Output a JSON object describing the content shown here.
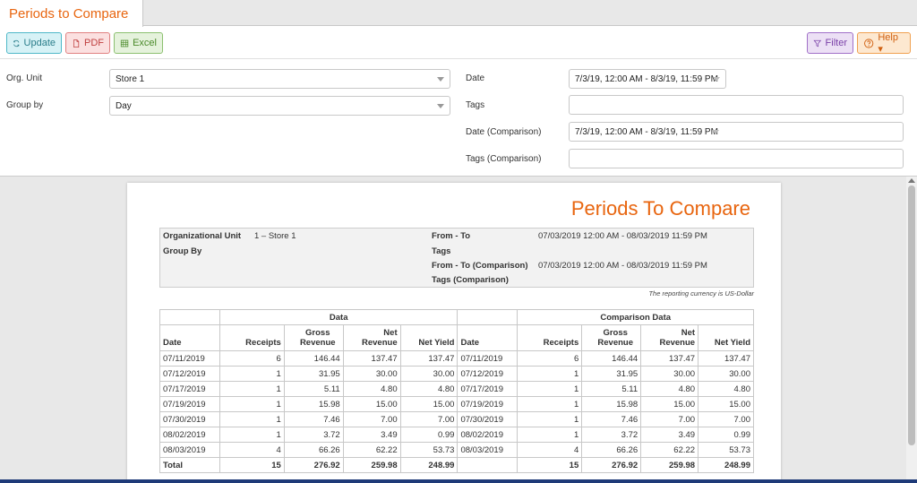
{
  "tab": {
    "title": "Periods to Compare"
  },
  "toolbar": {
    "update": "Update",
    "pdf": "PDF",
    "excel": "Excel",
    "filter": "Filter",
    "help": "Help ▾"
  },
  "form": {
    "org_unit_label": "Org. Unit",
    "org_unit_value": "Store 1",
    "group_by_label": "Group by",
    "group_by_value": "Day",
    "date_label": "Date",
    "date_value": "7/3/19, 12:00 AM - 8/3/19, 11:59 PM",
    "tags_label": "Tags",
    "tags_value": "",
    "date_cmp_label": "Date (Comparison)",
    "date_cmp_value": "7/3/19, 12:00 AM - 8/3/19, 11:59 PM",
    "tags_cmp_label": "Tags (Comparison)",
    "tags_cmp_value": ""
  },
  "report": {
    "title": "Periods To Compare",
    "info": {
      "org_unit_label": "Organizational Unit",
      "org_unit_value": "1 – Store 1",
      "group_by_label": "Group By",
      "from_to_label": "From - To",
      "from_to_value": "07/03/2019 12:00 AM - 08/03/2019 11:59 PM",
      "tags_label": "Tags",
      "from_to_cmp_label": "From - To (Comparison)",
      "from_to_cmp_value": "07/03/2019 12:00 AM - 08/03/2019 11:59 PM",
      "tags_cmp_label": "Tags (Comparison)"
    },
    "currency_note": "The reporting currency is US-Dollar",
    "group_headers": {
      "data": "Data",
      "comparison": "Comparison Data"
    },
    "columns": [
      "Date",
      "Receipts",
      "Gross Revenue",
      "Net Revenue",
      "Net Yield"
    ],
    "rows": [
      [
        "07/11/2019",
        "6",
        "146.44",
        "137.47",
        "137.47",
        "07/11/2019",
        "6",
        "146.44",
        "137.47",
        "137.47"
      ],
      [
        "07/12/2019",
        "1",
        "31.95",
        "30.00",
        "30.00",
        "07/12/2019",
        "1",
        "31.95",
        "30.00",
        "30.00"
      ],
      [
        "07/17/2019",
        "1",
        "5.11",
        "4.80",
        "4.80",
        "07/17/2019",
        "1",
        "5.11",
        "4.80",
        "4.80"
      ],
      [
        "07/19/2019",
        "1",
        "15.98",
        "15.00",
        "15.00",
        "07/19/2019",
        "1",
        "15.98",
        "15.00",
        "15.00"
      ],
      [
        "07/30/2019",
        "1",
        "7.46",
        "7.00",
        "7.00",
        "07/30/2019",
        "1",
        "7.46",
        "7.00",
        "7.00"
      ],
      [
        "08/02/2019",
        "1",
        "3.72",
        "3.49",
        "0.99",
        "08/02/2019",
        "1",
        "3.72",
        "3.49",
        "0.99"
      ],
      [
        "08/03/2019",
        "4",
        "66.26",
        "62.22",
        "53.73",
        "08/03/2019",
        "4",
        "66.26",
        "62.22",
        "53.73"
      ]
    ],
    "total": [
      "Total",
      "15",
      "276.92",
      "259.98",
      "248.99",
      "",
      "15",
      "276.92",
      "259.98",
      "248.99"
    ]
  }
}
